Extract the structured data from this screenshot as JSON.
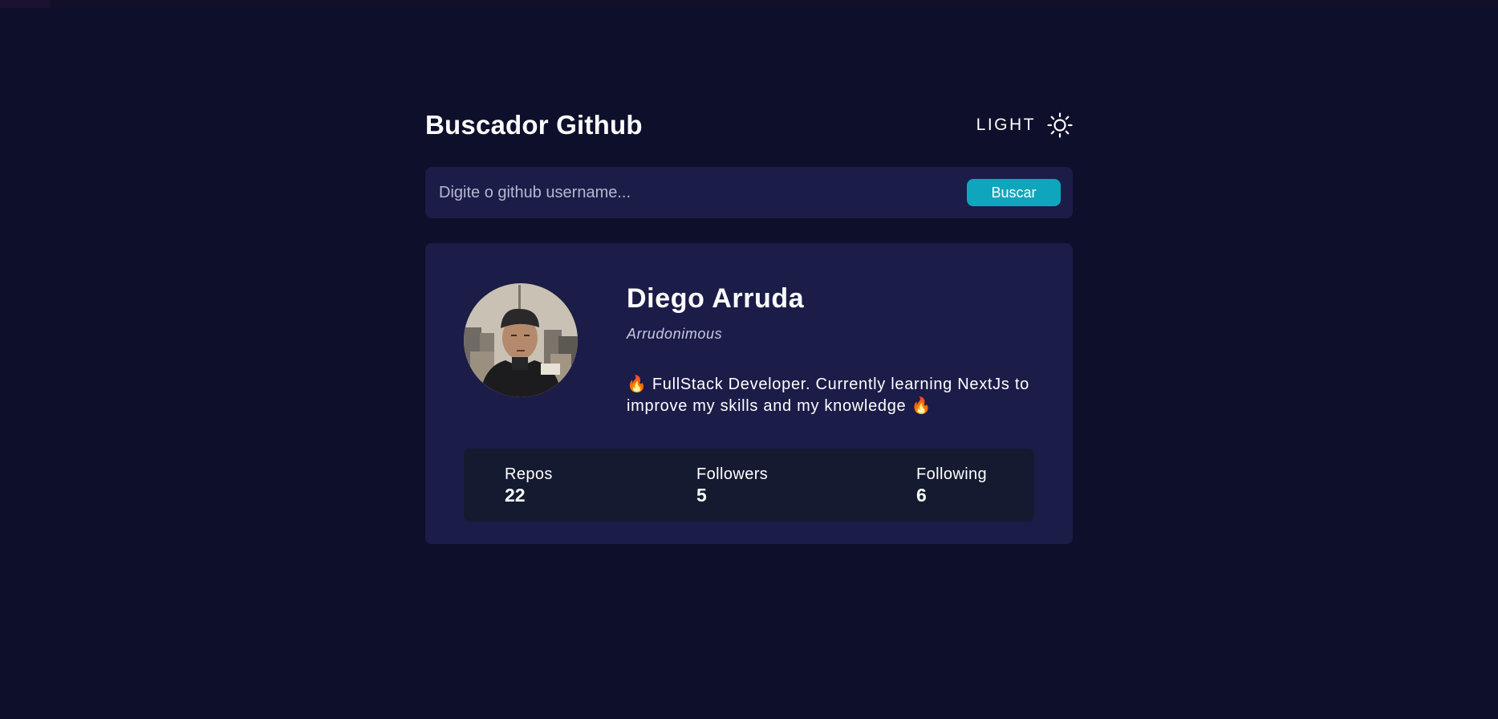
{
  "header": {
    "title": "Buscador Github",
    "theme_toggle_label": "LIGHT",
    "theme_icon": "sun-icon"
  },
  "search": {
    "placeholder": "Digite o github username...",
    "value": "",
    "button_label": "Buscar"
  },
  "profile": {
    "name": "Diego Arruda",
    "login": "Arrudonimous",
    "bio": "🔥 FullStack Developer. Currently learning NextJs to improve my skills and my knowledge 🔥",
    "stats": [
      {
        "label": "Repos",
        "value": "22"
      },
      {
        "label": "Followers",
        "value": "5"
      },
      {
        "label": "Following",
        "value": "6"
      }
    ]
  },
  "colors": {
    "background": "#0e0f2b",
    "card": "#1b1c48",
    "stats_panel": "#141a30",
    "accent": "#0fa6bd"
  }
}
